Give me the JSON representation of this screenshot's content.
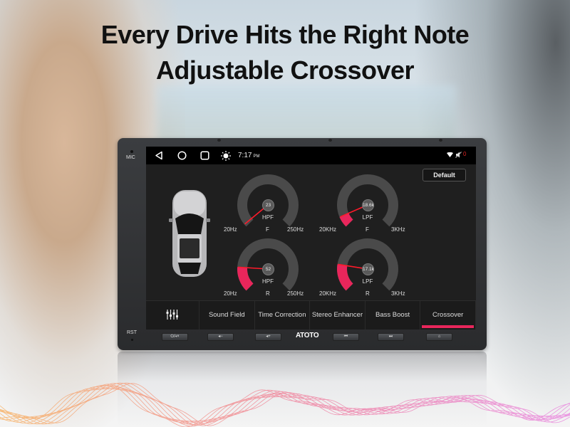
{
  "headline": {
    "line1": "Every Drive Hits the Right Note",
    "line2": "Adjustable Crossover"
  },
  "device": {
    "mic_label": "MIC",
    "rst_label": "RST",
    "brand": "ATOTO",
    "hardware_buttons": [
      {
        "icon": "power-mute-icon",
        "label": "⏻/◂×"
      },
      {
        "icon": "volume-down-icon",
        "label": "◂−"
      },
      {
        "icon": "volume-up-icon",
        "label": "◂+"
      },
      {
        "icon": "previous-track-icon",
        "label": "⏮"
      },
      {
        "icon": "next-track-icon",
        "label": "⏭"
      },
      {
        "icon": "home-icon",
        "label": "⌂"
      }
    ]
  },
  "statusbar": {
    "time": "7:17",
    "ampm": "PM",
    "notification_count": "0",
    "icons": [
      "back-icon",
      "home-icon",
      "recents-icon",
      "brightness-icon",
      "wifi-icon",
      "muted-speaker-icon"
    ]
  },
  "crossover": {
    "default_button": "Default",
    "accent_color": "#e8265b",
    "gauges": [
      {
        "id": "front-hpf",
        "value": "23",
        "type": "HPF",
        "channel": "F",
        "min_label": "20Hz",
        "max_label": "250Hz",
        "fraction": 0.02
      },
      {
        "id": "front-lpf",
        "value": "18.6k",
        "type": "LPF",
        "channel": "F",
        "min_label": "20KHz",
        "max_label": "3KHz",
        "fraction": 0.08
      },
      {
        "id": "rear-hpf",
        "value": "52",
        "type": "HPF",
        "channel": "R",
        "min_label": "20Hz",
        "max_label": "250Hz",
        "fraction": 0.18
      },
      {
        "id": "rear-lpf",
        "value": "17.1k",
        "type": "LPF",
        "channel": "R",
        "min_label": "20KHz",
        "max_label": "3KHz",
        "fraction": 0.2
      }
    ]
  },
  "tabs": [
    {
      "label": "",
      "icon": "equalizer-icon",
      "active": false
    },
    {
      "label": "Sound Field",
      "active": false
    },
    {
      "label": "Time Correction",
      "active": false
    },
    {
      "label": "Stereo Enhancer",
      "active": false
    },
    {
      "label": "Bass Boost",
      "active": false
    },
    {
      "label": "Crossover",
      "active": true
    }
  ]
}
